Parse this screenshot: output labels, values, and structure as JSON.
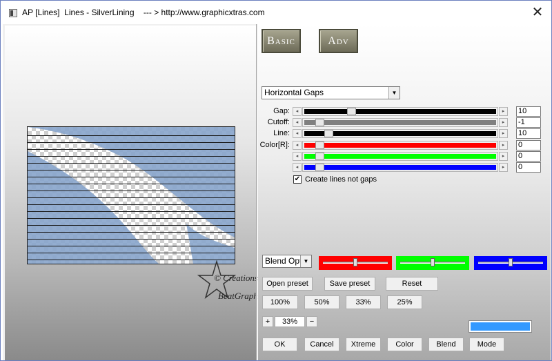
{
  "window": {
    "title": "AP [Lines]  Lines - SilverLining    --- > http://www.graphicxtras.com"
  },
  "header": {
    "basic_label": "Basic",
    "adv_label": "Adv"
  },
  "mode_select": {
    "value": "Horizontal Gaps"
  },
  "sliders": [
    {
      "label": "Gap:",
      "value": "10",
      "color": "#000000",
      "level": 0.18
    },
    {
      "label": "Cutoff:",
      "value": "-1",
      "color": "#808080",
      "level": 0.0
    },
    {
      "label": "Line:",
      "value": "10",
      "color": "#000000",
      "level": 0.05
    },
    {
      "label": "Color[R]:",
      "value": "0",
      "color": "#ff0000",
      "level": 0.0
    },
    {
      "label": "",
      "value": "0",
      "color": "#00ff00",
      "level": 0.0
    },
    {
      "label": "",
      "value": "0",
      "color": "#0000ff",
      "level": 0.0
    }
  ],
  "checkbox": {
    "label": "Create lines not gaps",
    "checked": true,
    "mark": "✔"
  },
  "blend_select": {
    "value": "Blend Options"
  },
  "color_sliders": [
    {
      "color": "#ff0000",
      "level": 0.5
    },
    {
      "color": "#00ff00",
      "level": 0.5
    },
    {
      "color": "#0000ff",
      "level": 0.5
    }
  ],
  "preset_buttons": {
    "open": "Open preset",
    "save": "Save preset",
    "reset": "Reset"
  },
  "zoom_buttons": [
    "100%",
    "50%",
    "33%",
    "25%"
  ],
  "zoom_control": {
    "plus": "+",
    "value": "33%",
    "minus": "−"
  },
  "color_swatch": "#3399ff",
  "bottom_buttons": [
    "OK",
    "Cancel",
    "Xtreme",
    "Color",
    "Blend",
    "Mode"
  ],
  "watermark": {
    "line1": "© Creations",
    "line2": "BeatGraph"
  },
  "icons": {
    "close": "close-icon",
    "app": "app-icon",
    "left_arrow": "◂",
    "right_arrow": "▸",
    "dropdown": "▼"
  }
}
